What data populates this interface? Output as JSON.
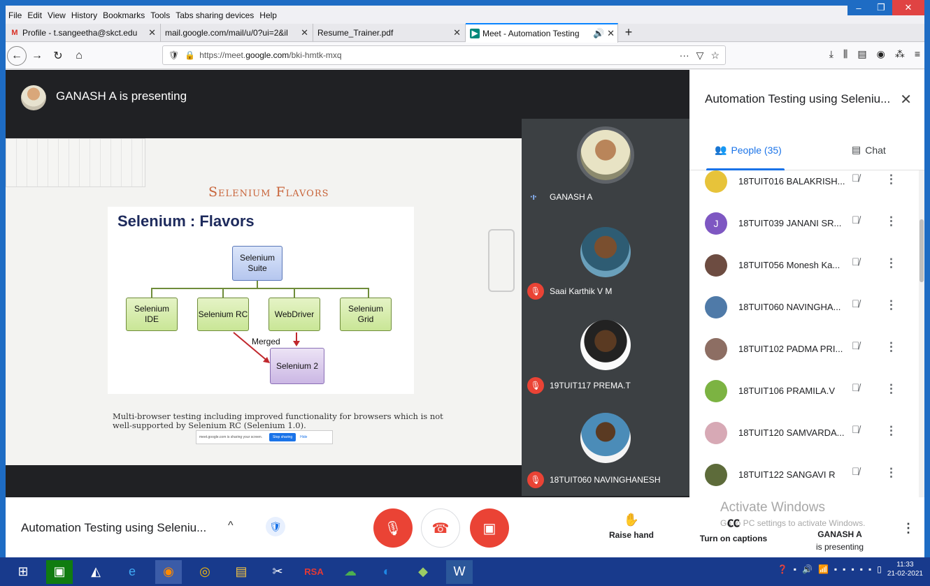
{
  "menu": [
    "File",
    "Edit",
    "View",
    "History",
    "Bookmarks",
    "Tools",
    "Tabs sharing devices",
    "Help"
  ],
  "window_controls": {
    "min": "–",
    "max": "❐",
    "close": "✕"
  },
  "tabs": [
    {
      "label": "Profile - t.sangeetha@skct.edu",
      "icon": "gmail-icon"
    },
    {
      "label": "mail.google.com/mail/u/0?ui=2&il",
      "icon": "none"
    },
    {
      "label": "Resume_Trainer.pdf",
      "icon": "none"
    },
    {
      "label": "Meet - Automation Testing",
      "icon": "meet-icon",
      "active": true
    }
  ],
  "nav": {
    "url_prefix": "https://meet.",
    "url_domain": "google.com",
    "url_path": "/bki-hmtk-mxq"
  },
  "presenter": {
    "text": "GANASH A is presenting"
  },
  "slide": {
    "title": "Selenium Flavors",
    "box_title": "Selenium : Flavors",
    "nodes": {
      "suite": "Selenium Suite",
      "ide": "Selenium IDE",
      "rc": "Selenium RC",
      "webdriver": "WebDriver",
      "grid": "Selenium Grid",
      "s2": "Selenium 2"
    },
    "merged": "Merged",
    "caption": "Multi-browser testing including improved functionality for browsers which is not well-supported by Selenium RC (Selenium 1.0).",
    "share_banner": {
      "text": "meet.google.com is sharing your screen.",
      "stop": "Stop sharing",
      "hide": "Hide"
    }
  },
  "tiles": [
    {
      "name": "GANASH A",
      "muted": false
    },
    {
      "name": "Saai Karthik V M",
      "muted": true
    },
    {
      "name": "19TUIT117 PREMA.T",
      "muted": true
    },
    {
      "name": "18TUIT060 NAVINGHANESH",
      "muted": true
    }
  ],
  "panel": {
    "title": "Automation Testing using Seleniu...",
    "people_tab": "People (35)",
    "chat_tab": "Chat",
    "people": [
      {
        "name": "18TUIT016 BALAKRISH...",
        "avatar_color": "#e7c33a",
        "initial": ""
      },
      {
        "name": "18TUIT039 JANANI SR...",
        "avatar_color": "#7e57c2",
        "initial": "J"
      },
      {
        "name": "18TUIT056 Monesh Ka...",
        "avatar_color": "#6d4c41",
        "initial": ""
      },
      {
        "name": "18TUIT060 NAVINGHA...",
        "avatar_color": "#4f7aa8",
        "initial": ""
      },
      {
        "name": "18TUIT102 PADMA PRI...",
        "avatar_color": "#8d6e63",
        "initial": ""
      },
      {
        "name": "18TUIT106 PRAMILA.V",
        "avatar_color": "#7cb342",
        "initial": ""
      },
      {
        "name": "18TUIT120 SAMVARDA...",
        "avatar_color": "#d7a9b5",
        "initial": ""
      },
      {
        "name": "18TUIT122 SANGAVI R",
        "avatar_color": "#5d6b3a",
        "initial": ""
      }
    ]
  },
  "bottom": {
    "meeting_name": "Automation Testing using Seleniu...",
    "raise_hand": "Raise hand",
    "captions": "Turn on captions",
    "presenter_name": "GANASH A",
    "presenter_state": "is presenting",
    "activate_title": "Activate Windows",
    "activate_sub": "Go to PC settings to activate Windows."
  },
  "taskbar": {
    "time": "11:33",
    "date": "21-02-2021"
  }
}
